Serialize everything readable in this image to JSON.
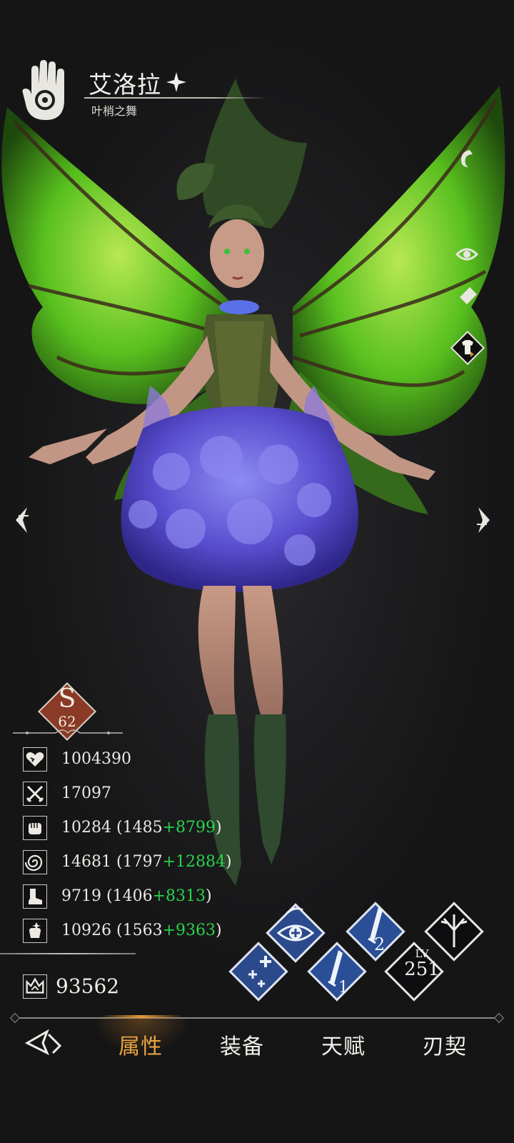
{
  "header": {
    "name": "艾洛拉",
    "outfit": "叶梢之舞"
  },
  "grade": {
    "letter": "S",
    "level": "62"
  },
  "stats": [
    {
      "icon": "heart-icon",
      "base": "1004390",
      "paren_open": "",
      "bonus": "",
      "paren_close": ""
    },
    {
      "icon": "crossed-swords-icon",
      "base": "17097",
      "paren_open": "",
      "bonus": "",
      "paren_close": ""
    },
    {
      "icon": "fist-icon",
      "base": "10284",
      "paren_open": " (1485",
      "bonus": "+8799",
      "paren_close": ")"
    },
    {
      "icon": "spiral-icon",
      "base": "14681",
      "paren_open": " (1797",
      "bonus": "+12884",
      "paren_close": ")"
    },
    {
      "icon": "boot-icon",
      "base": "9719",
      "paren_open": " (1406",
      "bonus": "+8313",
      "paren_close": ")"
    },
    {
      "icon": "hand-sparkle-icon",
      "base": "10926",
      "paren_open": " (1563",
      "bonus": "+9363",
      "paren_close": ")"
    }
  ],
  "power": "93562",
  "skills": {
    "skill1_num": "1",
    "skill2_num": "2",
    "lv_label": "LV",
    "lv_value": "251"
  },
  "nav": {
    "tabs": [
      "属性",
      "装备",
      "天赋",
      "刃契"
    ],
    "active": "属性"
  },
  "colors": {
    "bonus_green": "#27d44a",
    "active_tab": "#e9a33f",
    "grade_red": "#8a3a26"
  }
}
